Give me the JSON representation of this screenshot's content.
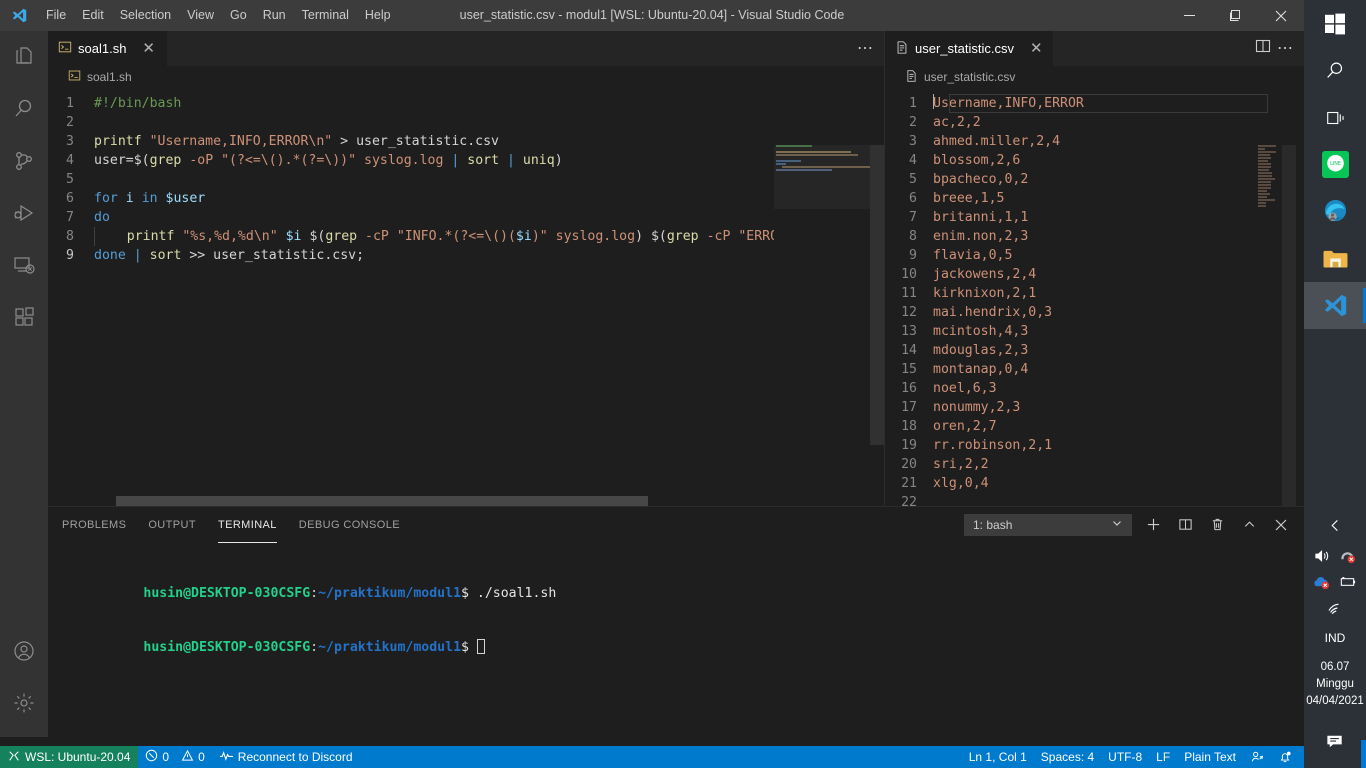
{
  "window": {
    "title": "user_statistic.csv - modul1 [WSL: Ubuntu-20.04] - Visual Studio Code",
    "controls": {
      "minimize": "minimize-icon",
      "maximize": "maximize-icon",
      "close": "close-icon"
    }
  },
  "menu": {
    "items": [
      "File",
      "Edit",
      "Selection",
      "View",
      "Go",
      "Run",
      "Terminal",
      "Help"
    ]
  },
  "activity_bar": {
    "items": [
      {
        "name": "explorer",
        "icon": "files-icon"
      },
      {
        "name": "search",
        "icon": "search-icon"
      },
      {
        "name": "source-control",
        "icon": "source-control-icon"
      },
      {
        "name": "run-and-debug",
        "icon": "debug-icon"
      },
      {
        "name": "remote-explorer",
        "icon": "remote-icon"
      },
      {
        "name": "extensions",
        "icon": "extensions-icon"
      }
    ],
    "bottom": [
      {
        "name": "accounts",
        "icon": "account-icon"
      },
      {
        "name": "manage",
        "icon": "gear-icon"
      }
    ]
  },
  "editor_left": {
    "tab": {
      "label": "soal1.sh",
      "icon": "shell-file-icon",
      "close": "✕"
    },
    "actions": {
      "more": "⋯"
    },
    "breadcrumb": {
      "label": "soal1.sh",
      "icon": "shell-file-icon"
    },
    "lines": [
      {
        "n": "1",
        "tokens": [
          {
            "c": "t-cmt",
            "t": "#!/bin/bash"
          }
        ]
      },
      {
        "n": "2",
        "tokens": []
      },
      {
        "n": "3",
        "tokens": [
          {
            "c": "t-fn",
            "t": "printf"
          },
          {
            "c": "t-plain",
            "t": " "
          },
          {
            "c": "t-str",
            "t": "\"Username,INFO,ERROR\\n\""
          },
          {
            "c": "t-plain",
            "t": " "
          },
          {
            "c": "t-op",
            "t": ">"
          },
          {
            "c": "t-plain",
            "t": " user_statistic.csv"
          }
        ]
      },
      {
        "n": "4",
        "tokens": [
          {
            "c": "t-plain",
            "t": "user="
          },
          {
            "c": "t-op",
            "t": "$("
          },
          {
            "c": "t-fn",
            "t": "grep"
          },
          {
            "c": "t-plain",
            "t": " "
          },
          {
            "c": "t-str",
            "t": "-oP"
          },
          {
            "c": "t-plain",
            "t": " "
          },
          {
            "c": "t-str",
            "t": "\"(?<=\\().*(?=\\))\""
          },
          {
            "c": "t-plain",
            "t": " "
          },
          {
            "c": "t-str",
            "t": "syslog.log"
          },
          {
            "c": "t-plain",
            "t": " "
          },
          {
            "c": "t-kw",
            "t": "|"
          },
          {
            "c": "t-plain",
            "t": " "
          },
          {
            "c": "t-fn",
            "t": "sort"
          },
          {
            "c": "t-plain",
            "t": " "
          },
          {
            "c": "t-kw",
            "t": "|"
          },
          {
            "c": "t-plain",
            "t": " "
          },
          {
            "c": "t-fn",
            "t": "uniq"
          },
          {
            "c": "t-op",
            "t": ")"
          }
        ]
      },
      {
        "n": "5",
        "tokens": []
      },
      {
        "n": "6",
        "tokens": [
          {
            "c": "t-kw",
            "t": "for"
          },
          {
            "c": "t-plain",
            "t": " "
          },
          {
            "c": "t-var",
            "t": "i"
          },
          {
            "c": "t-plain",
            "t": " "
          },
          {
            "c": "t-kw",
            "t": "in"
          },
          {
            "c": "t-plain",
            "t": " "
          },
          {
            "c": "t-var",
            "t": "$user"
          }
        ]
      },
      {
        "n": "7",
        "tokens": [
          {
            "c": "t-kw",
            "t": "do"
          }
        ]
      },
      {
        "n": "8",
        "indent": true,
        "tokens": [
          {
            "c": "t-plain",
            "t": "    "
          },
          {
            "c": "t-fn",
            "t": "printf"
          },
          {
            "c": "t-plain",
            "t": " "
          },
          {
            "c": "t-str",
            "t": "\"%s,%d,%d\\n\""
          },
          {
            "c": "t-plain",
            "t": " "
          },
          {
            "c": "t-var",
            "t": "$i"
          },
          {
            "c": "t-plain",
            "t": " "
          },
          {
            "c": "t-op",
            "t": "$("
          },
          {
            "c": "t-fn",
            "t": "grep"
          },
          {
            "c": "t-plain",
            "t": " "
          },
          {
            "c": "t-str",
            "t": "-cP"
          },
          {
            "c": "t-plain",
            "t": " "
          },
          {
            "c": "t-str",
            "t": "\"INFO.*(?<=\\()("
          },
          {
            "c": "t-var",
            "t": "$i"
          },
          {
            "c": "t-str",
            "t": ")\""
          },
          {
            "c": "t-plain",
            "t": " "
          },
          {
            "c": "t-str",
            "t": "syslog.log"
          },
          {
            "c": "t-op",
            "t": ")"
          },
          {
            "c": "t-plain",
            "t": " "
          },
          {
            "c": "t-op",
            "t": "$("
          },
          {
            "c": "t-fn",
            "t": "grep"
          },
          {
            "c": "t-plain",
            "t": " "
          },
          {
            "c": "t-str",
            "t": "-cP"
          },
          {
            "c": "t-plain",
            "t": " "
          },
          {
            "c": "t-str",
            "t": "\"ERRO"
          }
        ]
      },
      {
        "n": "9",
        "active": true,
        "tokens": [
          {
            "c": "t-kw",
            "t": "done"
          },
          {
            "c": "t-plain",
            "t": " "
          },
          {
            "c": "t-kw",
            "t": "|"
          },
          {
            "c": "t-plain",
            "t": " "
          },
          {
            "c": "t-fn",
            "t": "sort"
          },
          {
            "c": "t-plain",
            "t": " "
          },
          {
            "c": "t-op",
            "t": ">>"
          },
          {
            "c": "t-plain",
            "t": " user_statistic.csv;"
          }
        ]
      }
    ]
  },
  "editor_right": {
    "tab": {
      "label": "user_statistic.csv",
      "icon": "csv-file-icon",
      "close": "✕"
    },
    "actions": {
      "split": "split-editor-icon",
      "more": "⋯"
    },
    "breadcrumb": {
      "label": "user_statistic.csv",
      "icon": "csv-file-icon"
    },
    "lines": [
      {
        "n": "1",
        "t": "Username,INFO,ERROR",
        "caret": true
      },
      {
        "n": "2",
        "t": "ac,2,2"
      },
      {
        "n": "3",
        "t": "ahmed.miller,2,4"
      },
      {
        "n": "4",
        "t": "blossom,2,6"
      },
      {
        "n": "5",
        "t": "bpacheco,0,2"
      },
      {
        "n": "6",
        "t": "breee,1,5"
      },
      {
        "n": "7",
        "t": "britanni,1,1"
      },
      {
        "n": "8",
        "t": "enim.non,2,3"
      },
      {
        "n": "9",
        "t": "flavia,0,5"
      },
      {
        "n": "10",
        "t": "jackowens,2,4"
      },
      {
        "n": "11",
        "t": "kirknixon,2,1"
      },
      {
        "n": "12",
        "t": "mai.hendrix,0,3"
      },
      {
        "n": "13",
        "t": "mcintosh,4,3"
      },
      {
        "n": "14",
        "t": "mdouglas,2,3"
      },
      {
        "n": "15",
        "t": "montanap,0,4"
      },
      {
        "n": "16",
        "t": "noel,6,3"
      },
      {
        "n": "17",
        "t": "nonummy,2,3"
      },
      {
        "n": "18",
        "t": "oren,2,7"
      },
      {
        "n": "19",
        "t": "rr.robinson,2,1"
      },
      {
        "n": "20",
        "t": "sri,2,2"
      },
      {
        "n": "21",
        "t": "xlg,0,4"
      },
      {
        "n": "22",
        "t": ""
      }
    ]
  },
  "panel": {
    "tabs": [
      {
        "label": "PROBLEMS",
        "active": false
      },
      {
        "label": "OUTPUT",
        "active": false
      },
      {
        "label": "TERMINAL",
        "active": true
      },
      {
        "label": "DEBUG CONSOLE",
        "active": false
      }
    ],
    "terminal_select": {
      "value": "1: bash",
      "chevron": "chevron-down-icon"
    },
    "actions": [
      {
        "name": "new-terminal",
        "icon": "plus-icon",
        "glyph": "+"
      },
      {
        "name": "split-terminal",
        "icon": "split-icon",
        "glyph": "◫"
      },
      {
        "name": "kill-terminal",
        "icon": "trash-icon",
        "glyph": "🗑"
      },
      {
        "name": "maximize-panel",
        "icon": "chevron-up-icon",
        "glyph": "⌃"
      },
      {
        "name": "close-panel",
        "icon": "close-icon",
        "glyph": "✕"
      }
    ],
    "terminal": {
      "user_host": "husin@DESKTOP-030CSFG",
      "separator": ":",
      "path": "~/praktikum/modul1",
      "prompt_end": "$",
      "lines": [
        {
          "command": " ./soal1.sh",
          "cursor": false
        },
        {
          "command": " ",
          "cursor": true
        }
      ]
    }
  },
  "status_bar": {
    "remote": {
      "label": "WSL: Ubuntu-20.04",
      "icon": "remote-icon"
    },
    "problems": {
      "errors": "0",
      "warnings": "0",
      "error_icon": "error-circle-icon",
      "warning_icon": "warning-triangle-icon"
    },
    "discord": {
      "label": "Reconnect to Discord",
      "icon": "pulse-icon"
    },
    "right": [
      {
        "name": "editor-position",
        "label": "Ln 1, Col 1"
      },
      {
        "name": "indentation",
        "label": "Spaces: 4"
      },
      {
        "name": "encoding",
        "label": "UTF-8"
      },
      {
        "name": "eol",
        "label": "LF"
      },
      {
        "name": "language-mode",
        "label": "Plain Text"
      }
    ],
    "feedback_icon": "feedback-icon",
    "bell_icon": "bell-dot-icon"
  },
  "taskbar": {
    "items": [
      {
        "name": "start",
        "icon": "windows-logo-icon"
      },
      {
        "name": "search",
        "icon": "search-icon"
      },
      {
        "name": "task-view",
        "icon": "task-view-icon"
      },
      {
        "name": "line-app",
        "icon": "line-icon",
        "label": "LINE"
      },
      {
        "name": "microsoft-edge",
        "icon": "edge-icon"
      },
      {
        "name": "file-explorer",
        "icon": "folder-icon"
      },
      {
        "name": "visual-studio-code",
        "icon": "vscode-icon",
        "active": true
      }
    ],
    "tray": {
      "expand_icon": "chevron-left-icon",
      "icons": [
        {
          "name": "volume",
          "icon": "speaker-icon"
        },
        {
          "name": "headset-disconnected",
          "icon": "headset-error-icon"
        },
        {
          "name": "onedrive-error",
          "icon": "cloud-error-icon"
        },
        {
          "name": "battery-charging",
          "icon": "battery-icon"
        },
        {
          "name": "network",
          "icon": "wifi-icon"
        }
      ],
      "language": "IND",
      "clock": {
        "time": "06.07",
        "day": "Minggu",
        "date": "04/04/2021"
      },
      "action_center": "action-center-icon"
    }
  },
  "colors": {
    "accent": "#007acc",
    "remote_green": "#16825d",
    "taskbar": "#2b3137",
    "editor_bg": "#1e1e1e",
    "sidebar_bg": "#333333",
    "titlebar_bg": "#3c3c3c"
  }
}
